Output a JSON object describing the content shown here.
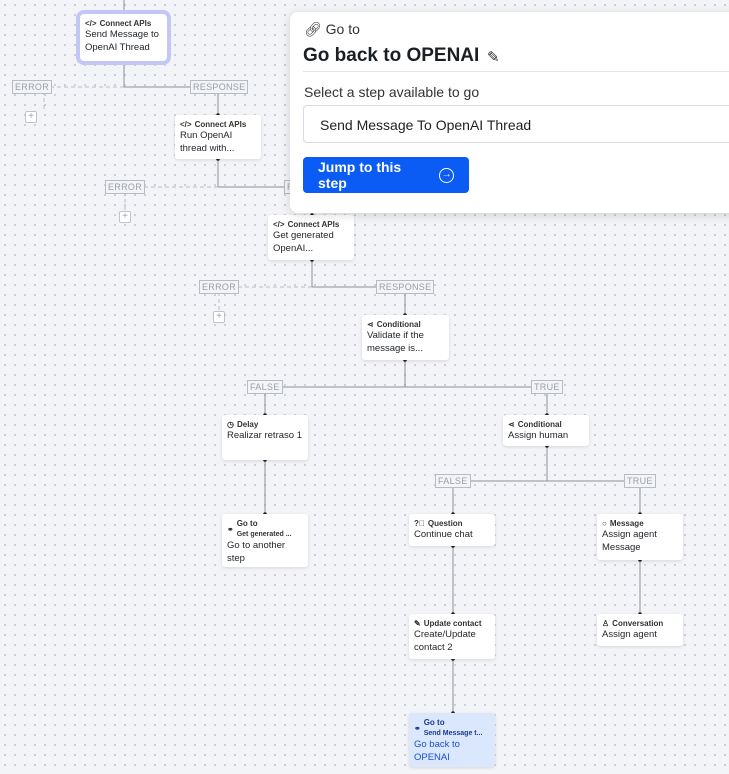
{
  "nodes": [
    {
      "kind": "Connect APIs",
      "title": "Send Message to OpenAI Thread",
      "icon": "code-icon"
    },
    {
      "kind": "Connect APIs",
      "title": "Run OpenAI thread with...",
      "icon": "code-icon"
    },
    {
      "kind": "Connect APIs",
      "title": "Get generated OpenAI...",
      "icon": "code-icon"
    },
    {
      "kind": "Conditional",
      "title": "Validate if the message is...",
      "icon": "branch-icon"
    },
    {
      "kind": "Delay",
      "title": "Realizar retraso 1",
      "icon": "clock-icon"
    },
    {
      "kind": "Conditional",
      "title": "Assign human",
      "icon": "branch-icon"
    },
    {
      "kind": "Go to",
      "sub": "Get generated ...",
      "title": "Go to another step",
      "icon": "link-icon"
    },
    {
      "kind": "Question",
      "title": "Continue chat",
      "icon": "question-icon"
    },
    {
      "kind": "Message",
      "title": "Assign agent Message",
      "icon": "chat-icon"
    },
    {
      "kind": "Update contact",
      "title": "Create/Update contact 2",
      "icon": "pencil-icon"
    },
    {
      "kind": "Conversation",
      "title": "Assign agent",
      "icon": "user-icon"
    },
    {
      "kind": "Go to",
      "sub": "Send Message t...",
      "title": "Go back to OPENAI",
      "icon": "link-icon"
    }
  ],
  "labels": {
    "error": "ERROR",
    "response": "RESPONSE",
    "false": "FALSE",
    "true": "TRUE",
    "plus": "+"
  },
  "panel": {
    "goto": "Go to",
    "title": "Go back to OPENAI",
    "select_label": "Select a step available to go",
    "select_value": "Send Message To OpenAI Thread",
    "button": "Jump to this step"
  },
  "colors": {
    "accent": "#0a5cf5",
    "selected_outline": "#c3c7f7",
    "active_node": "#dbe7fd"
  }
}
